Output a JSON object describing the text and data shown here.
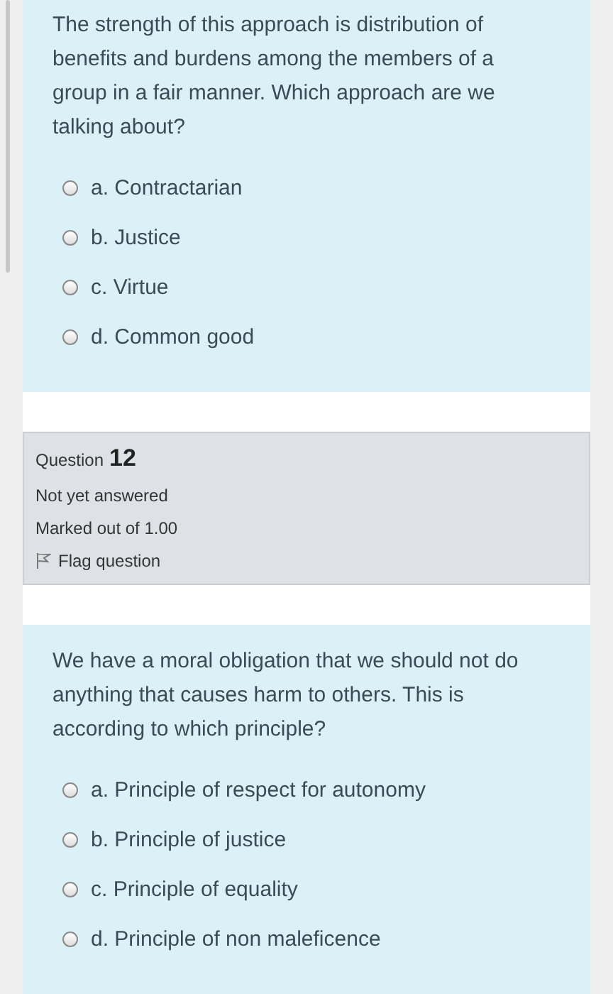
{
  "questions": [
    {
      "text": "The strength of this approach is distribution of benefits and burdens among the members of a group in a fair manner. Which approach are we talking about?",
      "options": [
        {
          "label": "a. Contractarian",
          "selected": false
        },
        {
          "label": "b. Justice",
          "selected": false
        },
        {
          "label": "c. Virtue",
          "selected": false
        },
        {
          "label": "d. Common good",
          "selected": false
        }
      ]
    },
    {
      "info": {
        "question_label": "Question",
        "number": "12",
        "status": "Not yet answered",
        "marks": "Marked out of 1.00",
        "flag": "Flag question"
      },
      "text": "We have a moral obligation that we should not do anything that causes harm to others. This is according to which principle?",
      "options": [
        {
          "label": "a. Principle of respect for autonomy",
          "selected": false
        },
        {
          "label": "b. Principle of justice",
          "selected": false
        },
        {
          "label": "c. Principle of equality",
          "selected": false
        },
        {
          "label": "d. Principle of non maleficence",
          "selected": false
        }
      ]
    }
  ]
}
